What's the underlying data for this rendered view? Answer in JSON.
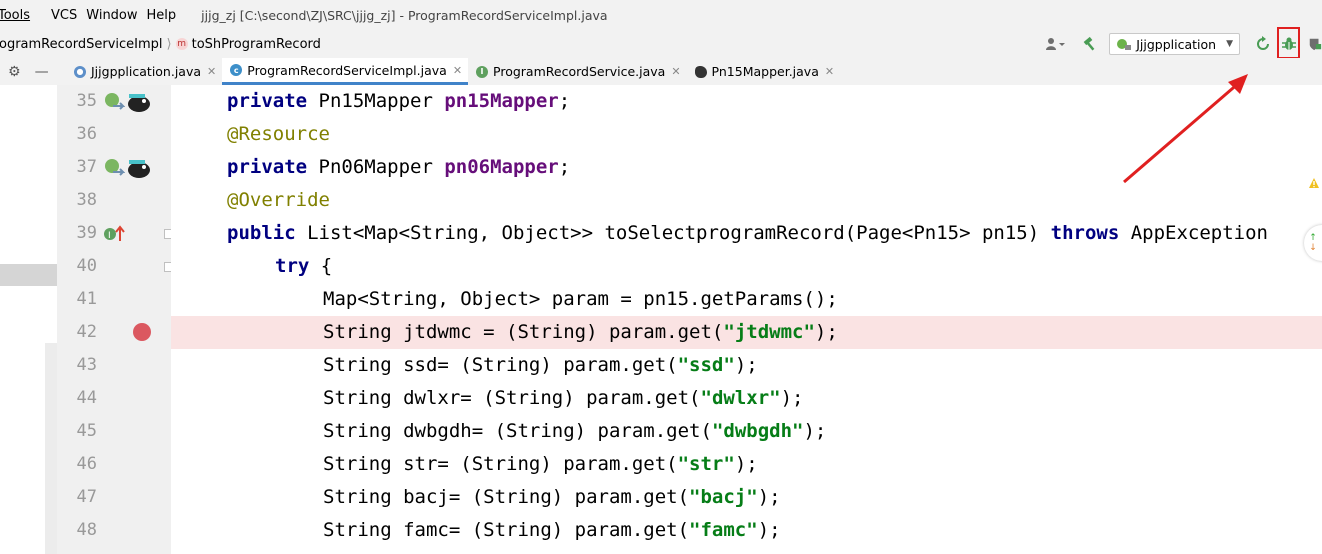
{
  "menubar": {
    "items": [
      "Tools",
      "VCS",
      "Window",
      "Help"
    ],
    "window_title": "jjjg_zj [C:\\second\\ZJ\\SRC\\jjjg_zj] - ProgramRecordServiceImpl.java"
  },
  "navbar": {
    "breadcrumb_class": "ogramRecordServiceImpl",
    "breadcrumb_method": "toShProgramRecord",
    "method_badge": "m",
    "run_config": "Jjjgpplication"
  },
  "tabs": [
    {
      "label": "Jjjgpplication.java",
      "icon": "spring-app-icon",
      "active": false
    },
    {
      "label": "ProgramRecordServiceImpl.java",
      "icon": "class-icon",
      "active": true
    },
    {
      "label": "ProgramRecordService.java",
      "icon": "interface-icon",
      "active": false
    },
    {
      "label": "Pn15Mapper.java",
      "icon": "mapper-icon",
      "active": false
    }
  ],
  "code": {
    "line_numbers": [
      "35",
      "36",
      "37",
      "38",
      "39",
      "40",
      "41",
      "42",
      "43",
      "44",
      "45",
      "46",
      "47",
      "48"
    ],
    "l35": {
      "kw": "private",
      "type": " Pn15Mapper ",
      "field": "pn15Mapper",
      "end": ";"
    },
    "l36": {
      "ann": "@Resource"
    },
    "l37": {
      "kw": "private",
      "type": " Pn06Mapper ",
      "field": "pn06Mapper",
      "end": ";"
    },
    "l38": {
      "ann": "@Override"
    },
    "l39": {
      "kw": "public",
      "mid": " List<Map<String, Object>> toSelectprogramRecord(Page<Pn15> pn15) ",
      "throws": "throws",
      "end": " AppException"
    },
    "l40": {
      "kw": "try",
      "end": " {"
    },
    "l41": {
      "text": "Map<String, Object> param = pn15.getParams();"
    },
    "l42": {
      "pre": "String jtdwmc = (String) param.get(",
      "str": "\"jtdwmc\"",
      "end": ");"
    },
    "l43": {
      "pre": "String ssd= (String) param.get(",
      "str": "\"ssd\"",
      "end": ");"
    },
    "l44": {
      "pre": "String dwlxr= (String) param.get(",
      "str": "\"dwlxr\"",
      "end": ");"
    },
    "l45": {
      "pre": "String dwbgdh= (String) param.get(",
      "str": "\"dwbgdh\"",
      "end": ");"
    },
    "l46": {
      "pre": "String str= (String) param.get(",
      "str": "\"str\"",
      "end": ");"
    },
    "l47": {
      "pre": "String bacj= (String) param.get(",
      "str": "\"bacj\"",
      "end": ");"
    },
    "l48": {
      "pre": "String famc= (String) param.get(",
      "str": "\"famc\"",
      "end": ");"
    }
  },
  "colors": {
    "keyword": "#000080",
    "annotation": "#808000",
    "field": "#660e7a",
    "string": "#067d17",
    "breakpoint": "#db5860",
    "highlight_box": "#e02020",
    "active_tab_underline": "#4083c9"
  }
}
